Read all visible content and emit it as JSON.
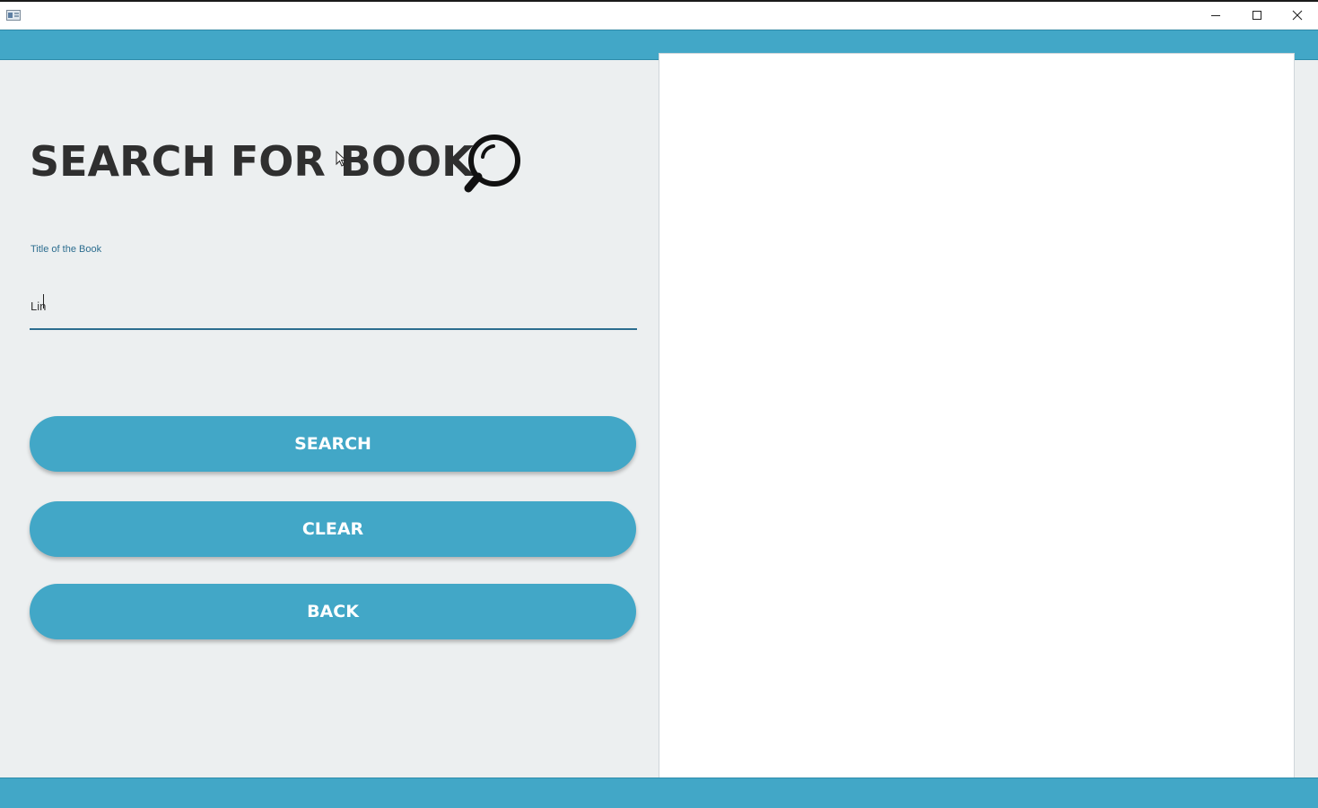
{
  "window": {
    "controls": {
      "minimize_icon": "minimize-icon",
      "maximize_icon": "maximize-icon",
      "close_icon": "close-icon"
    }
  },
  "page": {
    "title": "SEARCH FOR BOOK",
    "title_icon": "search-icon"
  },
  "form": {
    "title_field": {
      "label": "Title of the Book",
      "value": "Lin"
    }
  },
  "buttons": {
    "search": "SEARCH",
    "clear": "CLEAR",
    "back": "BACK"
  },
  "colors": {
    "accent": "#42a7c7",
    "background": "#eceff0",
    "heading": "#2f2f2f",
    "field_underline": "#2c6d8f"
  }
}
